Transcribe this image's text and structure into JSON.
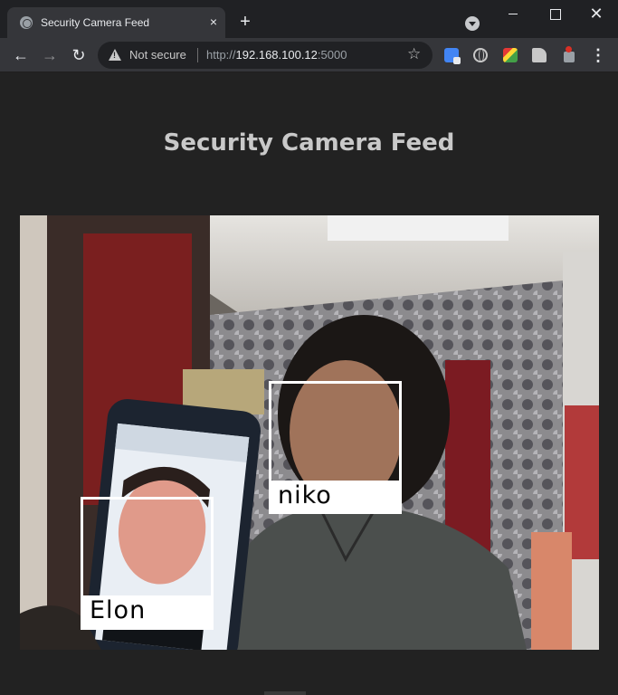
{
  "browser": {
    "tab_title": "Security Camera Feed",
    "tab_close_glyph": "×",
    "new_tab_glyph": "+",
    "security_label": "Not secure",
    "url_scheme": "http://",
    "url_host": "192.168.100.12",
    "url_port": ":5000",
    "icons": [
      "globe-favicon-icon",
      "close-icon",
      "plus-icon",
      "tab-search-icon",
      "minimize-icon",
      "maximize-icon",
      "close-window-icon",
      "back-arrow-icon",
      "forward-arrow-icon",
      "reload-icon",
      "warning-icon",
      "star-icon",
      "google-translate-icon",
      "globe-icon",
      "colorful-extension-icon",
      "puzzle-icon",
      "red-badge-extension-icon",
      "more-menu-icon"
    ]
  },
  "page": {
    "heading": "Security Camera Feed"
  },
  "detections": [
    {
      "name": "niko",
      "color": "#ffffff"
    },
    {
      "name": "Elon",
      "color": "#ffffff"
    }
  ]
}
